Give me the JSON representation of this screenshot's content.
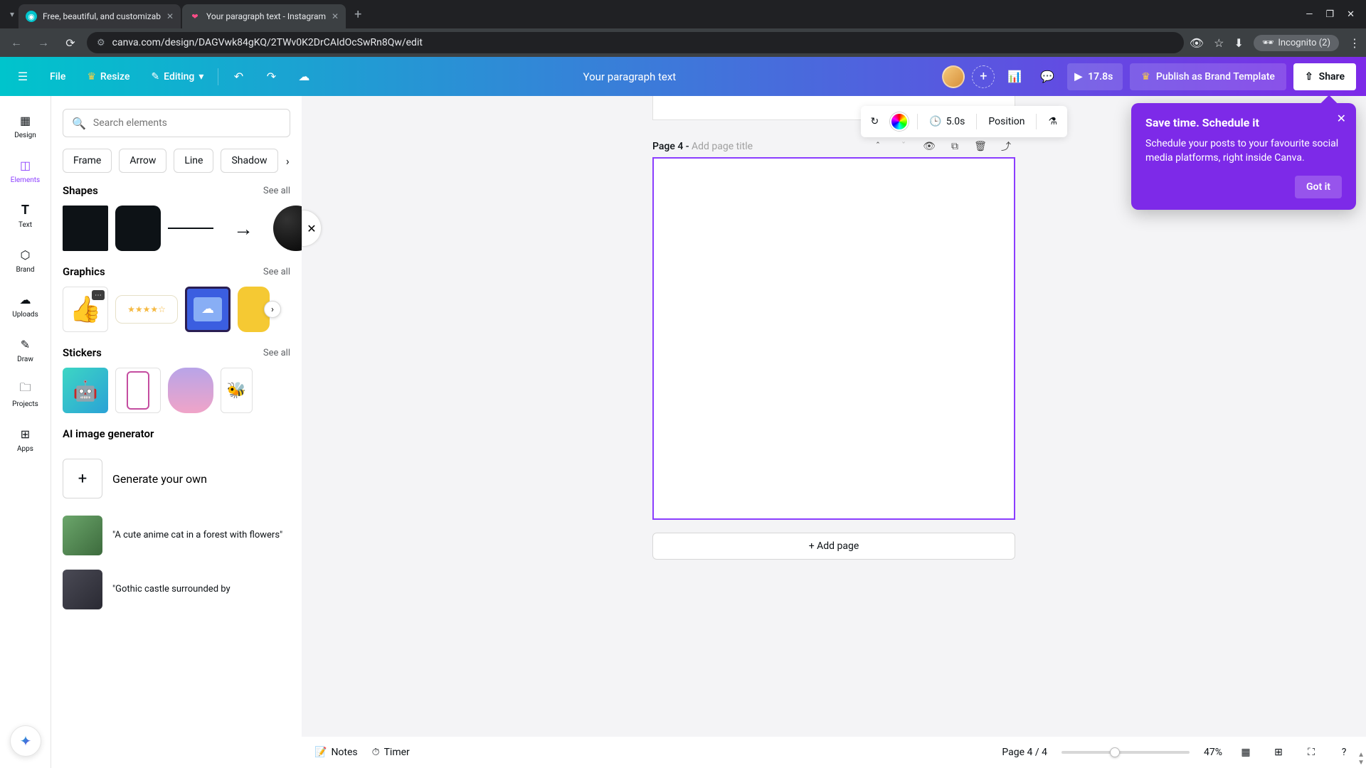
{
  "browser": {
    "tabs": [
      {
        "title": "Free, beautiful, and customizab",
        "favicon": "◉"
      },
      {
        "title": "Your paragraph text - Instagram",
        "favicon": "❤"
      }
    ],
    "url": "canva.com/design/DAGVwk84gKQ/2TWv0K2DrCAIdOcSwRn8Qw/edit",
    "incognito": "Incognito (2)"
  },
  "toolbar": {
    "file": "File",
    "resize": "Resize",
    "editing": "Editing",
    "doc_title": "Your paragraph text",
    "play_time": "17.8s",
    "publish": "Publish as Brand Template",
    "share": "Share"
  },
  "rail": {
    "design": "Design",
    "elements": "Elements",
    "text": "Text",
    "brand": "Brand",
    "uploads": "Uploads",
    "draw": "Draw",
    "projects": "Projects",
    "apps": "Apps"
  },
  "panel": {
    "search_placeholder": "Search elements",
    "chips": [
      "Frame",
      "Arrow",
      "Line",
      "Shadow"
    ],
    "shapes": {
      "title": "Shapes",
      "see_all": "See all"
    },
    "graphics": {
      "title": "Graphics",
      "see_all": "See all"
    },
    "stickers": {
      "title": "Stickers",
      "see_all": "See all"
    },
    "ai": {
      "title": "AI image generator",
      "generate": "Generate your own",
      "prompt1": "\"A cute anime cat in a forest with flowers\"",
      "prompt2": "\"Gothic castle surrounded by"
    }
  },
  "ctx": {
    "duration": "5.0s",
    "position": "Position"
  },
  "page": {
    "label": "Page 4 -",
    "placeholder": "Add page title",
    "add_page": "+ Add page"
  },
  "popover": {
    "title": "Save time. Schedule it",
    "body": "Schedule your posts to your favourite social media platforms, right inside Canva.",
    "got_it": "Got it"
  },
  "footer": {
    "notes": "Notes",
    "timer": "Timer",
    "pages": "Page 4 / 4",
    "zoom": "47%"
  }
}
